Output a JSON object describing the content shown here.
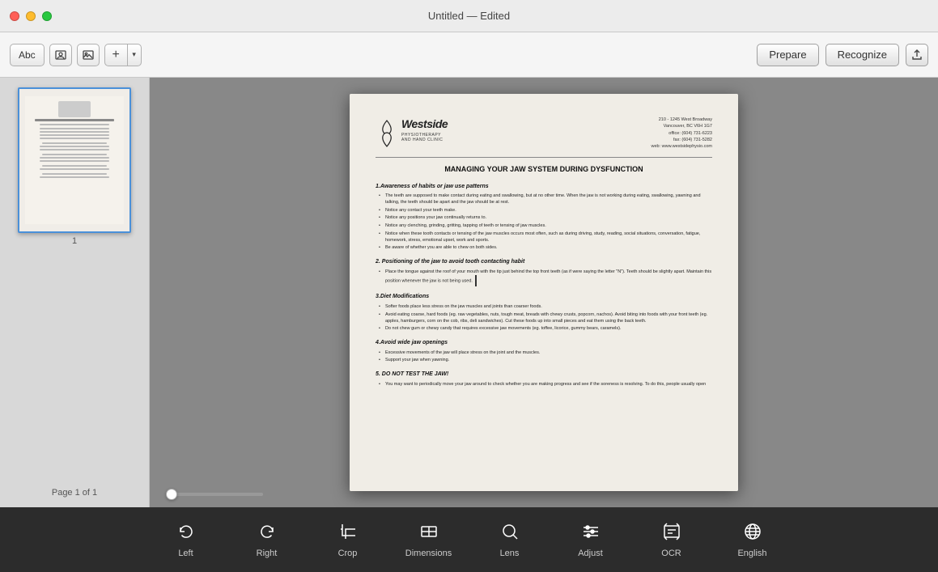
{
  "window": {
    "title": "Untitled — Edited"
  },
  "toolbar": {
    "abc_label": "Abc",
    "prepare_label": "Prepare",
    "recognize_label": "Recognize"
  },
  "sidebar": {
    "page_label": "1",
    "page_info": "Page 1 of 1"
  },
  "document": {
    "logo_main": "Westside",
    "logo_sub": "PHYSIOTHERAPY\nAND HAND CLINIC",
    "address_line1": "210 - 1245 West Broadway",
    "address_line2": "Vancouver, BC  V6H 1G7",
    "address_phone": "office: (604) 731-6223",
    "address_fax": "fax: (604) 731-5282",
    "address_web": "web: www.westsidephysio.com",
    "title": "MANAGING YOUR JAW SYSTEM DURING DYSFUNCTION",
    "section1_title": "1.Awareness of habits or jaw use patterns",
    "section1_bullets": [
      "The teeth are supposed to make contact during eating and swallowing, but at no other time. When the jaw is not working during eating, swallowing, yawning and talking, the teeth should be apart and the jaw should be at rest.",
      "Notice any contact your teeth make.",
      "Notice any positions your jaw continually returns to.",
      "Notice any clenching, grinding, gritting, tapping of teeth or tensing of jaw muscles.",
      "Notice when these tooth contacts or tensing of the jaw muscles occurs most often, such as during driving, study, reading, social situations, conversation, fatigue, homework, stress, emotional upset, work and sports.",
      "Be aware of whether you are able to chew on both sides."
    ],
    "section2_title": "2. Positioning of the jaw to avoid tooth contacting habit",
    "section2_bullets": [
      "Place the tongue against the roof of your mouth with the tip just behind the top front teeth (as if were saying the letter \"N\"). Teeth should be slightly apart. Maintain this position whenever the jaw is not being used."
    ],
    "section3_title": "3.Diet Modifications",
    "section3_bullets": [
      "Softer foods place less stress on the jaw muscles and joints than coarser foods.",
      "Avoid eating coarse, hard foods (eg. raw vegetables, nuts, tough meat, breads with chewy crusts, popcorn, nachos). Avoid biting into foods with your front teeth (eg. apples, hamburgers, corn on the cob, ribs, deli sandwiches). Cut these foods up into small pieces and eat them using the back teeth.",
      "Do not chew gum or chewy candy that requires excessive jaw movements (eg. toffee, licorice, gummy bears, caramels)."
    ],
    "section4_title": "4.Avoid wide jaw openings",
    "section4_bullets": [
      "Excessive movements of the jaw will place stress on the joint and the muscles.",
      "Support your jaw when yawning."
    ],
    "section5_title": "5. DO NOT TEST THE JAW!",
    "section5_bullets": [
      "You may want to periodically move your jaw around to check whether you are making progress and see if the soreness is resolving. To do this, people usually open"
    ]
  },
  "bottom_toolbar": {
    "items": [
      {
        "id": "rotate-left",
        "label": "Left",
        "icon": "rotate-left"
      },
      {
        "id": "rotate-right",
        "label": "Right",
        "icon": "rotate-right"
      },
      {
        "id": "crop",
        "label": "Crop",
        "icon": "crop"
      },
      {
        "id": "dimensions",
        "label": "Dimensions",
        "icon": "dimensions"
      },
      {
        "id": "lens",
        "label": "Lens",
        "icon": "lens"
      },
      {
        "id": "adjust",
        "label": "Adjust",
        "icon": "adjust"
      },
      {
        "id": "ocr",
        "label": "OCR",
        "icon": "ocr"
      },
      {
        "id": "language",
        "label": "English",
        "icon": "language"
      }
    ]
  }
}
